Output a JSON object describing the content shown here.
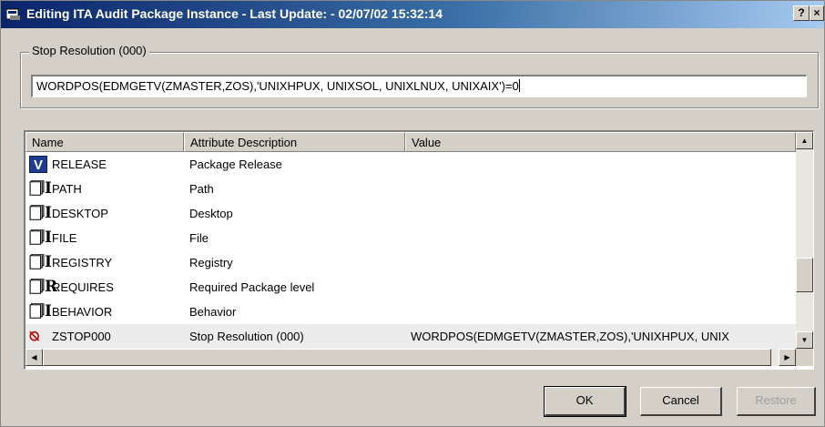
{
  "window": {
    "title": "Editing ITA Audit Package Instance - Last Update: - 02/07/02 15:32:14",
    "help_label": "?",
    "close_label": "×"
  },
  "stop_resolution": {
    "group_label": "Stop Resolution (000)",
    "expression": "WORDPOS(EDMGETV(ZMASTER,ZOS),'UNIXHPUX, UNIXSOL, UNIXLNUX, UNIXAIX')=0"
  },
  "table": {
    "columns": [
      "Name",
      "Attribute Description",
      "Value"
    ],
    "rows": [
      {
        "icon": "v-badge-icon",
        "glyph": "V",
        "name": "RELEASE",
        "description": "Package Release",
        "value": ""
      },
      {
        "icon": "attribute-icon",
        "glyph": "🗍I",
        "name": "PATH",
        "description": "Path",
        "value": ""
      },
      {
        "icon": "attribute-icon",
        "glyph": "🗍I",
        "name": "DESKTOP",
        "description": "Desktop",
        "value": ""
      },
      {
        "icon": "attribute-icon",
        "glyph": "🗍I",
        "name": "FILE",
        "description": "File",
        "value": ""
      },
      {
        "icon": "attribute-icon",
        "glyph": "🗍I",
        "name": "REGISTRY",
        "description": "Registry",
        "value": ""
      },
      {
        "icon": "required-attribute-icon",
        "glyph": "🗍R",
        "name": "REQUIRES",
        "description": "Required Package level",
        "value": ""
      },
      {
        "icon": "attribute-icon",
        "glyph": "🗍I",
        "name": "BEHAVIOR",
        "description": "Behavior",
        "value": ""
      },
      {
        "icon": "stop-icon",
        "glyph": "⦰",
        "name": "ZSTOP000",
        "description": "Stop Resolution (000)",
        "value": "WORDPOS(EDMGETV(ZMASTER,ZOS),'UNIXHPUX, UNIX"
      }
    ],
    "selected_row": 7
  },
  "buttons": {
    "ok": "OK",
    "cancel": "Cancel",
    "restore": "Restore"
  }
}
